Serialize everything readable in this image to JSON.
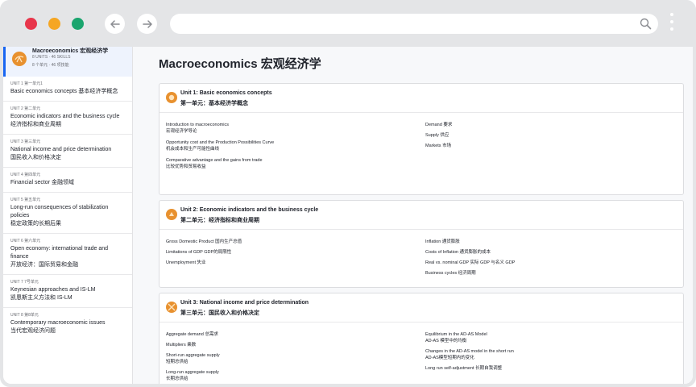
{
  "browser": {
    "traffic_lights": [
      "#e8364b",
      "#f5a623",
      "#1aa56e"
    ],
    "back_label": "back",
    "forward_label": "forward",
    "url_placeholder": "",
    "search_icon": "search-icon",
    "menu_icon": "more-vertical-icon"
  },
  "course": {
    "title": "Macroeconomics 宏观经济学",
    "units_skills": "8 UNITS · 46 SKILLS",
    "units_skills_cn": "8 个单元 · 46 项技能",
    "icon_color": "#e8912f"
  },
  "sidebar": {
    "units": [
      {
        "kicker": "UNIT 1 第一单元1",
        "name": "Basic economics concepts 基本经济学概念"
      },
      {
        "kicker": "UNIT 2 第二单元",
        "name": "Economic indicators and the business cycle",
        "name_cn": "经济指标和商业周期"
      },
      {
        "kicker": "UNIT 3 第三单元",
        "name": "National income and price determination",
        "name_cn": "国民收入和价格决定"
      },
      {
        "kicker": "UNIT 4 第四单元",
        "name": "Financial sector 金融领域"
      },
      {
        "kicker": "UNIT 5 第五单元",
        "name": "Long-run consequences of stabilization policies",
        "name_cn": "稳定政策的长期后果"
      },
      {
        "kicker": "UNIT 6 第六单元",
        "name": "Open economy: international trade and finance",
        "name_cn": "开放经济：国际贸易和金融"
      },
      {
        "kicker": "UNIT 7 7号单元",
        "name": "Keynesian approaches and IS-LM",
        "name_cn": "凯恩斯主义方法和 IS-LM"
      },
      {
        "kicker": "UNIT 8 第8单元",
        "name": "Contemporary macroeconomic issues",
        "name_cn": "当代宏观经济问题"
      }
    ]
  },
  "main": {
    "page_title": "Macroeconomics 宏观经济学",
    "cards": [
      {
        "title": "Unit 1: Basic economics concepts",
        "title_cn": "第一单元：基本经济学概念",
        "left": [
          "Introduction to macroeconomics",
          "宏观经济学导论",
          "",
          "Opportunity cost and the Production Possibilities Curve",
          "机会成本和生产可能性曲线",
          "",
          "Comparative advantage and the gains from trade",
          "比较优势和贸易收益"
        ],
        "right": [
          "Demand 要求",
          "",
          "Supply 供应",
          "",
          "Markets 市场"
        ]
      },
      {
        "title": "Unit 2: Economic indicators and the business cycle",
        "title_cn": "第二单元：经济指标和商业周期",
        "left": [
          "Gross Domestic Product 国内生产总值",
          "",
          "Limitations of GDP GDP的局限性",
          "",
          "Unemployment 失业"
        ],
        "right": [
          "Inflation 通货膨胀",
          "",
          "Costs of Inflation 通货膨胀的成本",
          "",
          "Real vs. nominal GDP 实际 GDP 与名义 GDP",
          "",
          "Business cycles 经济周期"
        ]
      },
      {
        "title": "Unit 3: National income and price determination",
        "title_cn": "第三单元：国民收入和价格决定",
        "left": [
          "Aggregate demand 总需求",
          "",
          "Multipliers 乘数",
          "",
          "Short-run aggregate supply",
          "短期总供给",
          "",
          "Long-run aggregate supply",
          "长期总供给"
        ],
        "right": [
          "Equilibrium in the AD-AS Model",
          "AD-AS 模型中的均衡",
          "",
          "Changes in the AD-AS model in the short run",
          "AD-AS模型短期内的变化",
          "",
          "Long run self-adjustment 长期自我调整"
        ]
      }
    ]
  }
}
